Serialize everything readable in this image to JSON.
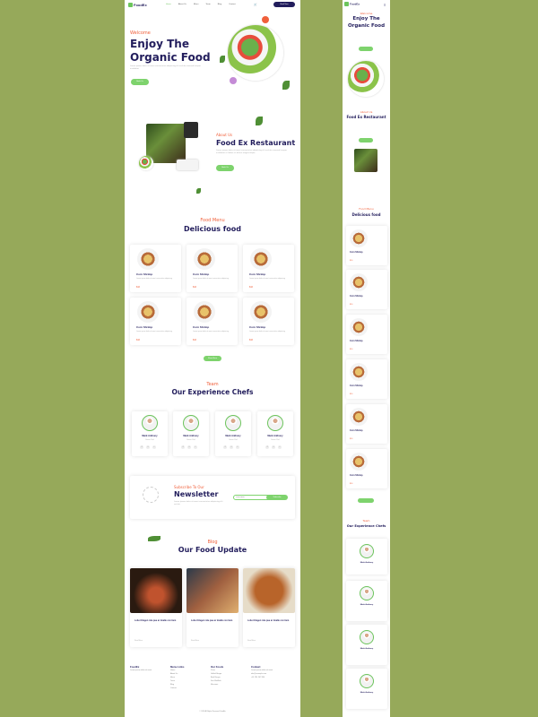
{
  "nav": {
    "logo": "FoodEx",
    "items": [
      "Home",
      "About Us",
      "Menu",
      "Team",
      "Blog",
      "Contact"
    ],
    "cart": "🛒",
    "cta": "Book Now"
  },
  "hero": {
    "welcome": "Welcome",
    "title1": "Enjoy The",
    "title2": "Organic Food",
    "body": "Lorem ipsum dolor sit amet consectetur adipiscing elit sed do eiusmod tempor incididunt",
    "button": "Book Us"
  },
  "about": {
    "sub": "About Us",
    "title": "Food Ex Restaurant",
    "body": "Lorem ipsum dolor sit amet consectetur adipiscing elit sed do eiusmod tempor incididunt ut labore et dolore magna aliqua",
    "button": "Book Us"
  },
  "menu": {
    "sub": "Food Menu",
    "title": "Delicious food",
    "items": [
      {
        "name": "Corn Shrimp",
        "desc": "Lorem ipsum dolor sit amet consectetur adipiscing",
        "price": "$16"
      },
      {
        "name": "Corn Shrimp",
        "desc": "Lorem ipsum dolor sit amet consectetur adipiscing",
        "price": "$16"
      },
      {
        "name": "Corn Shrimp",
        "desc": "Lorem ipsum dolor sit amet consectetur adipiscing",
        "price": "$16"
      },
      {
        "name": "Corn Shrimp",
        "desc": "Lorem ipsum dolor sit amet consectetur adipiscing",
        "price": "$16"
      },
      {
        "name": "Corn Shrimp",
        "desc": "Lorem ipsum dolor sit amet consectetur adipiscing",
        "price": "$16"
      },
      {
        "name": "Corn Shrimp",
        "desc": "Lorem ipsum dolor sit amet consectetur adipiscing",
        "price": "$16"
      }
    ],
    "button": "Show More"
  },
  "team": {
    "sub": "Team",
    "title": "Our Experience Chefs",
    "chefs": [
      {
        "name": "Mark Anthony",
        "role": "Senior Chef"
      },
      {
        "name": "Mark Anthony",
        "role": "Senior Chef"
      },
      {
        "name": "Mark Anthony",
        "role": "Senior Chef"
      },
      {
        "name": "Mark Anthony",
        "role": "Senior Chef"
      }
    ]
  },
  "newsletter": {
    "sub": "Subscribe To Our",
    "title": "Newsletter",
    "body": "Lorem ipsum dolor sit amet consectetur adipiscing elit sed do",
    "placeholder": "Your Email",
    "button": "Subscribe"
  },
  "blog": {
    "sub": "Blog",
    "title": "Our Food Update",
    "posts": [
      {
        "title": "Lobor Elegen role pue ar tmalle con tiem",
        "link": "Read More"
      },
      {
        "title": "Lobor Elegen role pue ar tmalle con tiem",
        "link": "Read More"
      },
      {
        "title": "Lobor Elegen role pue ar tmalle con tiem",
        "link": "Read More"
      }
    ]
  },
  "footer": {
    "col1": {
      "title": "FoodEx",
      "text": "Lorem ipsum dolor sit amet"
    },
    "col2": {
      "title": "Menu Links",
      "items": [
        "Home",
        "About Us",
        "Menu",
        "Team",
        "Blog",
        "Contact"
      ]
    },
    "col3": {
      "title": "Our Foods",
      "items": [
        "Pizza",
        "Grilled Burger",
        "Beef Burger",
        "Sea Shellfish",
        "Macaroni"
      ]
    },
    "col4": {
      "title": "Contact",
      "items": [
        "Lorem ipsum dolor sit amet",
        "info@example.com",
        "+01 234 567 890"
      ]
    },
    "copyright": "© 2023 All Rights Reserved. FoodEx"
  },
  "mobile": {
    "logo": "FoodEx",
    "welcome": "Welcome",
    "title1": "Enjoy The",
    "title2": "Organic Food",
    "aboutSub": "About Us",
    "aboutTitle": "Food Ex Restaurant",
    "menuSub": "Food Menu",
    "menuTitle": "Delicious food",
    "dishName": "Corn Shrimp",
    "price": "$16",
    "teamSub": "Team",
    "teamTitle": "Our Experience Chefs",
    "chefName": "Mark Anthony"
  }
}
